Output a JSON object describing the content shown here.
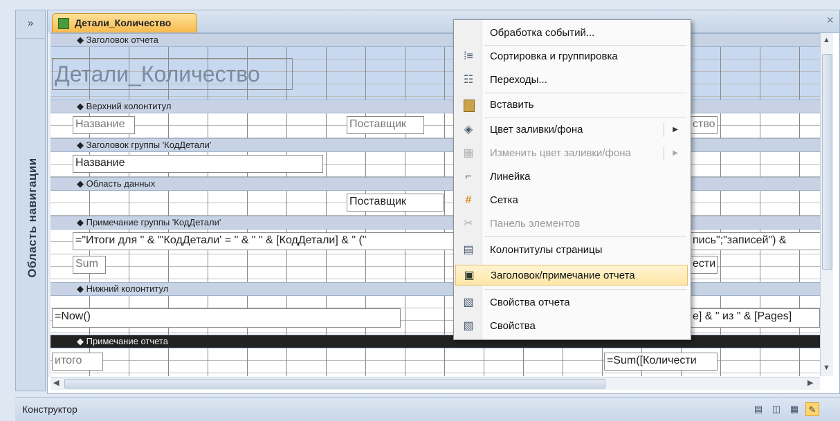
{
  "nav_pane": {
    "toggle": "»",
    "label": "Область навигации"
  },
  "document": {
    "tab_label": "Детали_Количество",
    "close": "×"
  },
  "report": {
    "sections": [
      {
        "label": "Заголовок отчета"
      },
      {
        "label": "Верхний колонтитул"
      },
      {
        "label": "Заголовок группы 'КодДетали'"
      },
      {
        "label": "Область данных"
      },
      {
        "label": "Примечание группы 'КодДетали'"
      },
      {
        "label": "Нижний колонтитул"
      },
      {
        "label": "Примечание отчета"
      }
    ],
    "controls": {
      "report_title": "Детали_Количество",
      "page_header_name": "Название",
      "page_header_supplier": "Поставщик",
      "page_header_qty": "ство",
      "group_header_name": "Название",
      "detail_supplier": "Поставщик",
      "group_footer_expr_left": "=\"Итоги для \" & \"'КодДетали' = \" & \" \" & [КодДетали] & \" (\"",
      "group_footer_expr_right": "пись\";\"записей\") &",
      "group_footer_sum": "Sum",
      "group_footer_qty": "ести",
      "page_footer_now": "=Now()",
      "page_footer_pages": "e] & \" из \" & [Pages]",
      "report_footer_total": "итого",
      "report_footer_sum": "=Sum([Количести"
    }
  },
  "context_menu": {
    "items": [
      {
        "label": "Обработка событий...",
        "icon": "none",
        "glyph": ""
      },
      {
        "label": "Сортировка и группировка",
        "icon": "sort-group-icon",
        "glyph": "⁞≡"
      },
      {
        "label": "Переходы...",
        "icon": "tab-order-icon",
        "glyph": "☷"
      },
      {
        "label": "Вставить",
        "icon": "paste-icon",
        "glyph": "📋"
      },
      {
        "label": "Цвет заливки/фона",
        "icon": "fill-color-icon",
        "glyph": "◈"
      },
      {
        "label": "Изменить цвет заливки/фона",
        "icon": "alt-fill-color-icon",
        "glyph": "▦"
      },
      {
        "label": "Линейка",
        "icon": "ruler-icon",
        "glyph": "⌐"
      },
      {
        "label": "Сетка",
        "icon": "grid-icon",
        "glyph": "#"
      },
      {
        "label": "Панель элементов",
        "icon": "toolbox-icon",
        "glyph": "✂"
      },
      {
        "label": "Колонтитулы страницы",
        "icon": "page-header-footer-icon",
        "glyph": "▤"
      },
      {
        "label": "Заголовок/примечание отчета",
        "icon": "report-header-footer-icon",
        "glyph": "▣"
      },
      {
        "label": "Свойства отчета",
        "icon": "report-properties-icon",
        "glyph": "▧"
      },
      {
        "label": "Свойства",
        "icon": "properties-icon",
        "glyph": "▧"
      }
    ]
  },
  "status_bar": {
    "text": "Конструктор"
  },
  "colors": {
    "section_bar": "#c7d3e4",
    "title_band": "#c8d9ef",
    "menu_highlight": "#ffe6a6",
    "tab_active": "#f7b94c"
  }
}
